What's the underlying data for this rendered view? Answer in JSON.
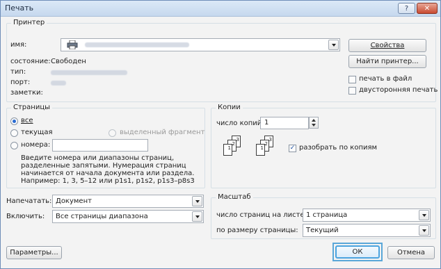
{
  "window": {
    "title": "Печать",
    "help": "?",
    "close": "✕"
  },
  "printer": {
    "legend": "Принтер",
    "name_label": "имя:",
    "status_label": "состояние:",
    "status_value": "Свободен",
    "type_label": "тип:",
    "port_label": "порт:",
    "notes_label": "заметки:",
    "properties_button": "Свойства",
    "find_button": "Найти принтер...",
    "print_to_file": "печать в файл",
    "duplex": "двусторонняя печать"
  },
  "pages": {
    "legend": "Страницы",
    "all": "все",
    "current": "текущая",
    "selection": "выделенный фрагмент",
    "pages_label": "номера:",
    "hint": [
      "Введите номера или диапазоны страниц,",
      "разделенные запятыми. Нумерация страниц",
      "начинается от начала документа или раздела.",
      "Например: 1, 3, 5–12 или p1s1, p1s2, p1s3–p8s3"
    ]
  },
  "copies": {
    "legend": "Копии",
    "count_label": "число копий:",
    "count_value": "1",
    "collate": "разобрать по копиям",
    "pages_icon": {
      "back": "3",
      "mid": "2",
      "front": "1"
    }
  },
  "print_what": {
    "label": "Напечатать:",
    "value": "Документ"
  },
  "print_range": {
    "label": "Включить:",
    "value": "Все страницы диапазона"
  },
  "zoom": {
    "legend": "Масштаб",
    "pages_per_sheet_label": "число страниц на листе:",
    "pages_per_sheet_value": "1 страница",
    "scale_label": "по размеру страницы:",
    "scale_value": "Текущий"
  },
  "footer": {
    "options": "Параметры...",
    "ok": "ОК",
    "cancel": "Отмена"
  }
}
